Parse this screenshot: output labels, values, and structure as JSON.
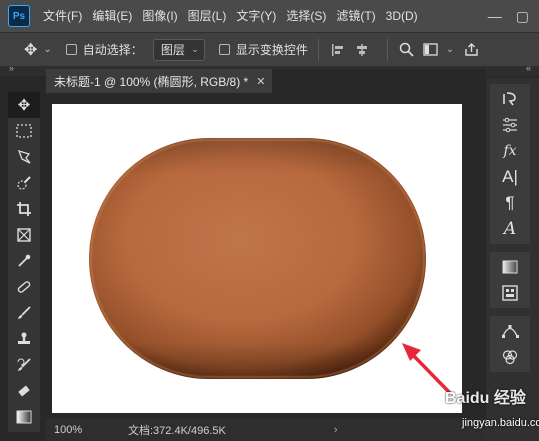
{
  "app": {
    "logo": "Ps",
    "menu": [
      "文件(F)",
      "编辑(E)",
      "图像(I)",
      "图层(L)",
      "文字(Y)",
      "选择(S)",
      "滤镜(T)",
      "3D(D)"
    ],
    "window_controls": [
      "minimize-icon",
      "maximize-icon",
      "close-icon"
    ]
  },
  "options": {
    "auto_select_label": "自动选择：",
    "auto_select_target": "图层",
    "show_transform_label": "显示变换控件"
  },
  "document": {
    "tab_title": "未标题-1 @ 100% (椭圆形, RGB/8) *",
    "zoom": "100%",
    "doc_info": "文档:372.4K/496.5K"
  },
  "shape": {
    "fill_colors": [
      "#c47844",
      "#a95c31",
      "#8a4221",
      "#5a2a12"
    ]
  },
  "annotation": {
    "arrow_color": "#e8283a"
  },
  "watermark": {
    "logo_text": "Baidu 经验",
    "url": "jingyan.baidu.com"
  },
  "tools": [
    "move-icon",
    "marquee-icon",
    "lasso-icon",
    "quick-select-icon",
    "crop-icon",
    "frame-icon",
    "eyedropper-icon",
    "healing-icon",
    "brush-icon",
    "stamp-icon",
    "history-brush-icon",
    "eraser-icon",
    "gradient-icon"
  ],
  "right_panel": {
    "group1": [
      "history-icon",
      "adjustments-icon",
      "styles-icon",
      "character-icon",
      "paragraph-icon",
      "glyphs-icon"
    ],
    "group2": [
      "gradients-icon",
      "libraries-icon"
    ],
    "group3": [
      "paths-icon",
      "channels-icon",
      "layers-icon"
    ]
  }
}
